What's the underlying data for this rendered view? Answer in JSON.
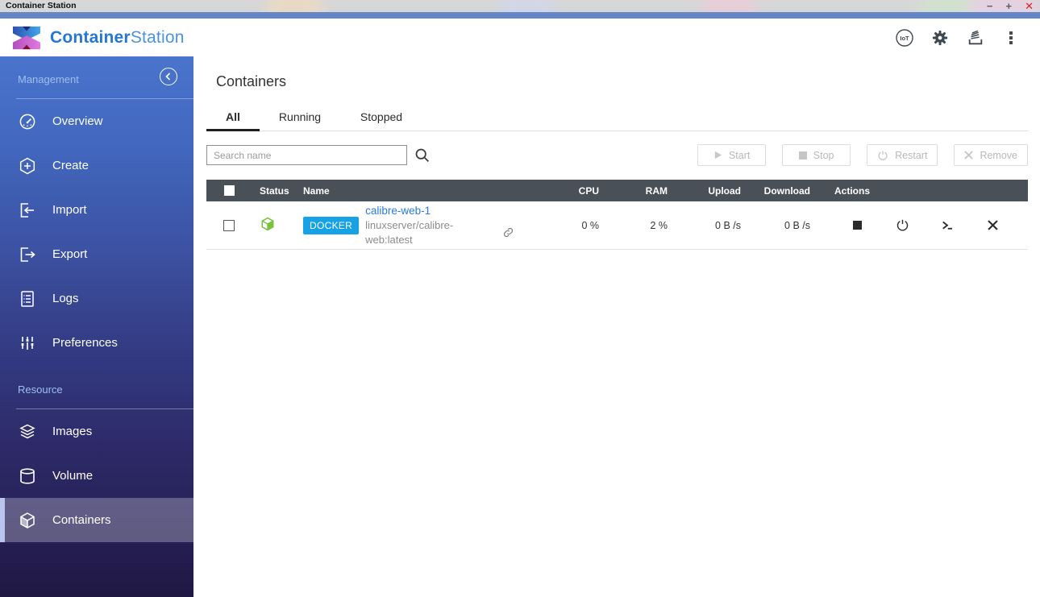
{
  "window": {
    "title": "Container Station",
    "controls": {
      "minimize": "−",
      "maximize": "+",
      "close": "✕"
    }
  },
  "app_header": {
    "brand_bold": "Container",
    "brand_light": "Station",
    "iot_label": "IoT",
    "icons": [
      "iot-icon",
      "gear-icon",
      "events-icon",
      "kebab-menu-icon"
    ]
  },
  "sidebar": {
    "sections": [
      {
        "label": "Management",
        "items": [
          {
            "label": "Overview",
            "icon": "gauge-icon"
          },
          {
            "label": "Create",
            "icon": "create-hexagon-plus-icon"
          },
          {
            "label": "Import",
            "icon": "import-icon"
          },
          {
            "label": "Export",
            "icon": "export-icon"
          },
          {
            "label": "Logs",
            "icon": "logs-document-icon"
          },
          {
            "label": "Preferences",
            "icon": "sliders-icon"
          }
        ]
      },
      {
        "label": "Resource",
        "items": [
          {
            "label": "Images",
            "icon": "layers-icon"
          },
          {
            "label": "Volume",
            "icon": "cylinder-icon"
          },
          {
            "label": "Containers",
            "icon": "cube-icon",
            "active": true
          }
        ]
      }
    ]
  },
  "main": {
    "title": "Containers",
    "tabs": [
      {
        "label": "All",
        "active": true
      },
      {
        "label": "Running",
        "active": false
      },
      {
        "label": "Stopped",
        "active": false
      }
    ],
    "search": {
      "placeholder": "Search name"
    },
    "toolbar_buttons": [
      {
        "label": "Start",
        "icon": "play-icon",
        "enabled": false
      },
      {
        "label": "Stop",
        "icon": "stop-icon",
        "enabled": false
      },
      {
        "label": "Restart",
        "icon": "power-icon",
        "enabled": false
      },
      {
        "label": "Remove",
        "icon": "x-icon",
        "enabled": false
      }
    ],
    "table": {
      "columns": {
        "status": "Status",
        "name": "Name",
        "cpu": "CPU",
        "ram": "RAM",
        "upload": "Upload",
        "download": "Download",
        "actions": "Actions"
      },
      "rows": [
        {
          "status": "running",
          "type_badge": "DOCKER",
          "name": "calibre-web-1",
          "image": "linuxserver/calibre-web:latest",
          "cpu": "0 %",
          "ram": "2 %",
          "upload": "0 B /s",
          "download": "0 B /s",
          "actions": [
            "stop-icon",
            "power-icon",
            "terminal-icon",
            "remove-icon"
          ]
        }
      ]
    }
  },
  "colors": {
    "brand_blue": "#2577d4",
    "brand_blue_light": "#4b93dd",
    "titlebar_bg": "#d7d7d7",
    "blue_strip": "#6485c6",
    "sidebar_top": "#4a74cd",
    "sidebar_bottom": "#1f1843",
    "sidebar_section_label": "#9cc0f0",
    "sidebar_active_stripe": "#b9c5ee",
    "table_header_bg": "#495057",
    "docker_badge_bg": "#17a2e5",
    "link_blue": "#2a7cd8",
    "status_green": "#76c143",
    "close_red": "#d22525",
    "muted_text": "#8c8c8c",
    "disabled_text": "#b8b8b8"
  }
}
